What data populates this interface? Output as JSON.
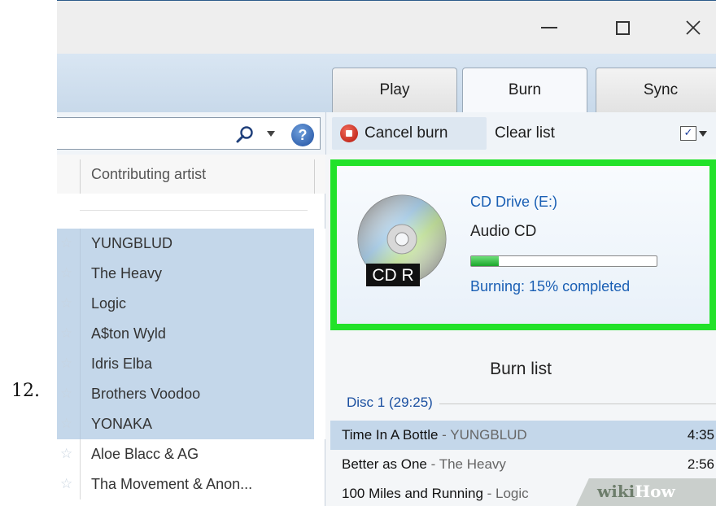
{
  "step_number": "12.",
  "window": {
    "controls": {
      "minimize": "minimize-icon",
      "maximize": "maximize-icon",
      "close": "close-icon"
    }
  },
  "tabs": [
    {
      "label": "Play",
      "active": false
    },
    {
      "label": "Burn",
      "active": true
    },
    {
      "label": "Sync",
      "active": false
    }
  ],
  "toolbar": {
    "search_placeholder": "",
    "cancel_burn_label": "Cancel burn",
    "clear_list_label": "Clear list",
    "check_mark": "✓"
  },
  "library": {
    "column_header": "Contributing artist",
    "artists": [
      {
        "name": "YUNGBLUD",
        "selected": true
      },
      {
        "name": "The Heavy",
        "selected": true
      },
      {
        "name": "Logic",
        "selected": true
      },
      {
        "name": "A$ton Wyld",
        "selected": true
      },
      {
        "name": "Idris Elba",
        "selected": true
      },
      {
        "name": "Brothers Voodoo",
        "selected": true
      },
      {
        "name": "YONAKA",
        "selected": true
      },
      {
        "name": "Aloe Blacc & AG",
        "selected": false
      },
      {
        "name": "Tha Movement & Anon...",
        "selected": false
      }
    ]
  },
  "burn_status": {
    "drive": "CD Drive (E:)",
    "disc_type": "Audio CD",
    "disc_label": "CD R",
    "progress_fraction": 0.15,
    "progress_text": "Burning: 15% completed"
  },
  "burn_list": {
    "title": "Burn list",
    "disc_header": "Disc 1 (29:25)",
    "tracks": [
      {
        "title": "Time In A Bottle",
        "artist": "YUNGBLUD",
        "duration": "4:35",
        "selected": true
      },
      {
        "title": "Better as One",
        "artist": "The Heavy",
        "duration": "2:56",
        "selected": false
      },
      {
        "title": "100 Miles and Running",
        "artist": "Logic",
        "duration": "",
        "selected": false
      }
    ]
  },
  "watermark": {
    "part1": "wiki",
    "part2": "How"
  },
  "colors": {
    "highlight_border": "#22e22a",
    "selection": "#c4d7ea",
    "link_blue": "#1a5fb4"
  }
}
